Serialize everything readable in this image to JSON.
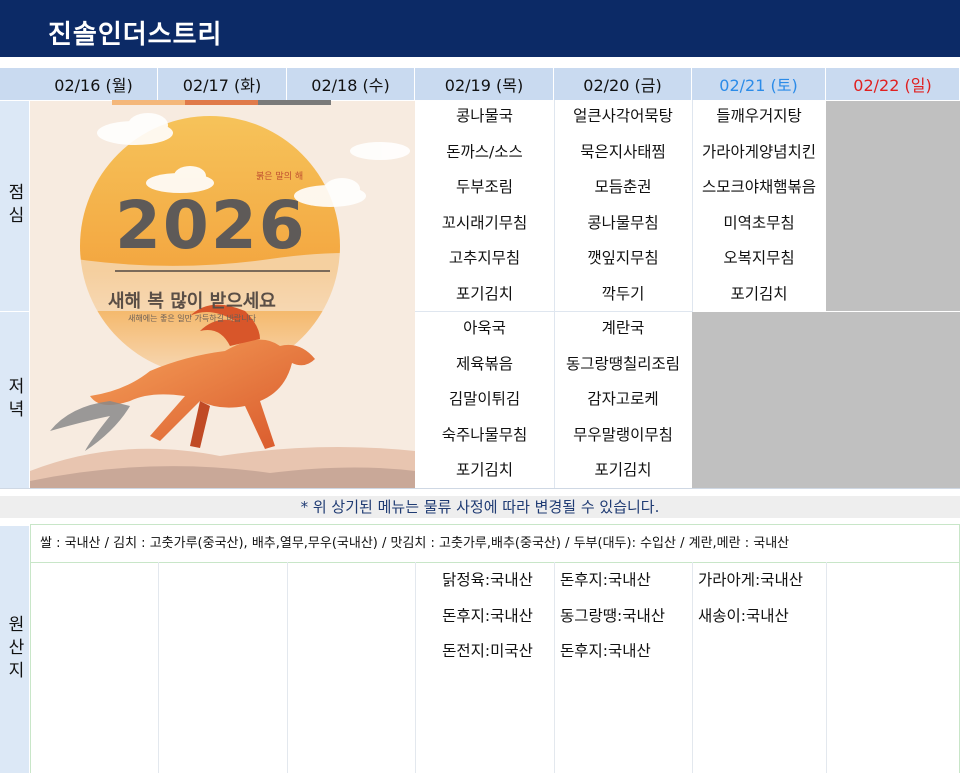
{
  "header": {
    "title": "진솔인더스트리"
  },
  "days": [
    {
      "label": "02/16 (월)",
      "color": "#111111"
    },
    {
      "label": "02/17 (화)",
      "color": "#111111"
    },
    {
      "label": "02/18 (수)",
      "color": "#111111"
    },
    {
      "label": "02/19 (목)",
      "color": "#111111"
    },
    {
      "label": "02/20 (금)",
      "color": "#111111"
    },
    {
      "label": "02/21 (토)",
      "color": "#2b8be8"
    },
    {
      "label": "02/22 (일)",
      "color": "#e02020"
    }
  ],
  "rows": {
    "lunch": "점심",
    "dinner": "저녁",
    "origin": "원산지"
  },
  "lunch": {
    "thu": [
      "콩나물국",
      "돈까스/소스",
      "두부조림",
      "꼬시래기무침",
      "고추지무침",
      "포기김치"
    ],
    "fri": [
      "얼큰사각어묵탕",
      "묵은지사태찜",
      "모듬춘권",
      "콩나물무침",
      "깻잎지무침",
      "깍두기"
    ],
    "sat": [
      "들깨우거지탕",
      "가라아게양념치킨",
      "스모크야채햄볶음",
      "미역초무침",
      "오복지무침",
      "포기김치"
    ]
  },
  "dinner": {
    "thu": [
      "아욱국",
      "제육볶음",
      "김말이튀김",
      "숙주나물무침",
      "포기김치"
    ],
    "fri": [
      "계란국",
      "동그랑땡칠리조림",
      "감자고로케",
      "무우말랭이무침",
      "포기김치"
    ]
  },
  "banner": {
    "kicker": "붉은 말의 해",
    "year": "2026",
    "headline": "새해 복 많이 받으세요",
    "sub": "새해에는 좋은 일만 가득하길 바랍니다"
  },
  "notice": "* 위 상기된 메뉴는 물류 사정에 따라 변경될 수 있습니다.",
  "origin": {
    "note": "쌀 : 국내산 / 김치 : 고춧가루(중국산), 배추,열무,무우(국내산) / 맛김치 : 고춧가루,배추(중국산) / 두부(대두): 수입산 / 계란,메란 : 국내산",
    "thu": [
      "닭정육:국내산",
      "돈후지:국내산",
      "돈전지:미국산"
    ],
    "fri": [
      "돈후지:국내산",
      "동그랑땡:국내산",
      "돈후지:국내산"
    ],
    "sat": [
      "가라아게:국내산",
      "새송이:국내산"
    ]
  },
  "colors": {
    "title_bg": "#0c2a66",
    "header_bg": "#c9daf0",
    "side_bg": "#dce8f6",
    "closed": "#c0c0c0",
    "saturday": "#2b8be8",
    "sunday": "#e02020"
  }
}
